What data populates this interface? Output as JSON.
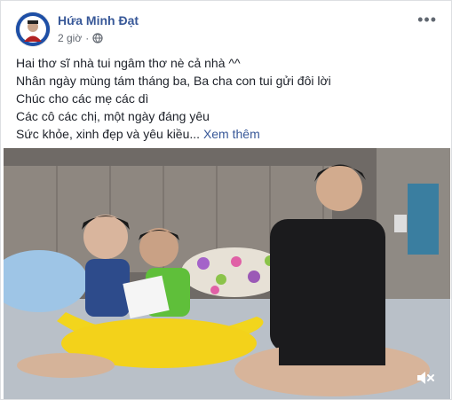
{
  "post": {
    "author": "Hứa Minh Đạt",
    "time": "2 giờ",
    "privacy_icon": "globe-icon",
    "more_icon": "ellipsis-icon",
    "lines": [
      "Hai thơ sĩ nhà tui ngâm thơ nè cả nhà ^^",
      "Nhân ngày mùng tám tháng ba, Ba cha con tui gửi đôi lời",
      "Chúc cho các mẹ các dì",
      "Các cô các chị, một ngày đáng yêu",
      "Sức khỏe, xinh đẹp và yêu kiều..."
    ],
    "see_more": "Xem thêm"
  },
  "video": {
    "mute_icon": "speaker-muted-icon"
  },
  "colors": {
    "link": "#385898",
    "text": "#1d2129",
    "meta": "#616770"
  }
}
